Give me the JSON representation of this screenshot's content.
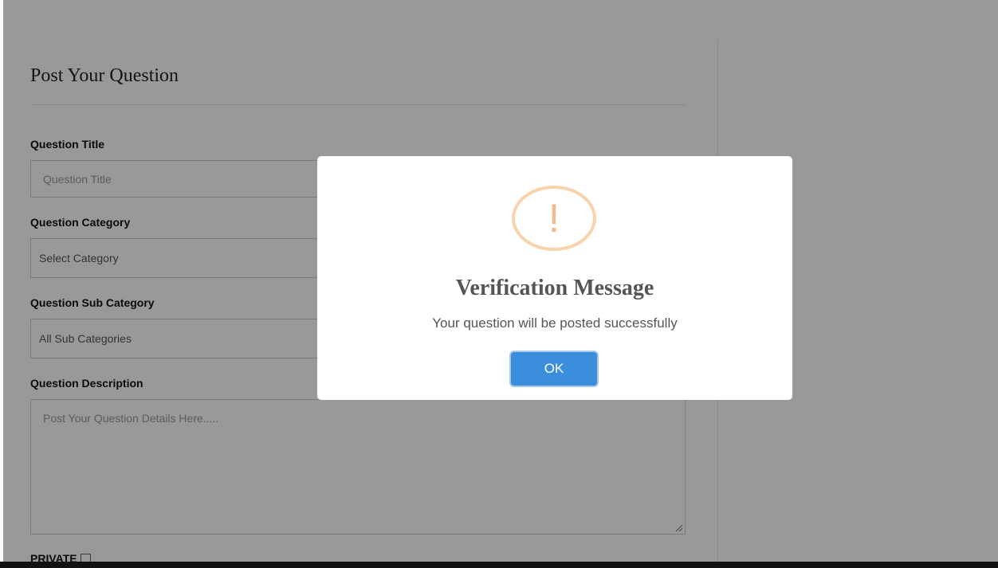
{
  "form": {
    "title": "Post Your Question",
    "question_title": {
      "label": "Question Title",
      "placeholder": "Question Title"
    },
    "question_category": {
      "label": "Question Category",
      "value": "Select Category"
    },
    "question_sub_category": {
      "label": "Question Sub Category",
      "value": "All Sub Categories"
    },
    "question_description": {
      "label": "Question Description",
      "placeholder": "Post Your Question Details Here....."
    },
    "private": {
      "label": "PRIVATE"
    }
  },
  "modal": {
    "icon": "warning-exclamation-icon",
    "icon_glyph": "!",
    "title": "Verification Message",
    "message": "Your question will be posted successfully",
    "ok_label": "OK",
    "colors": {
      "ok_button": "#3b8edc",
      "warning_icon": "#f5b987"
    }
  }
}
